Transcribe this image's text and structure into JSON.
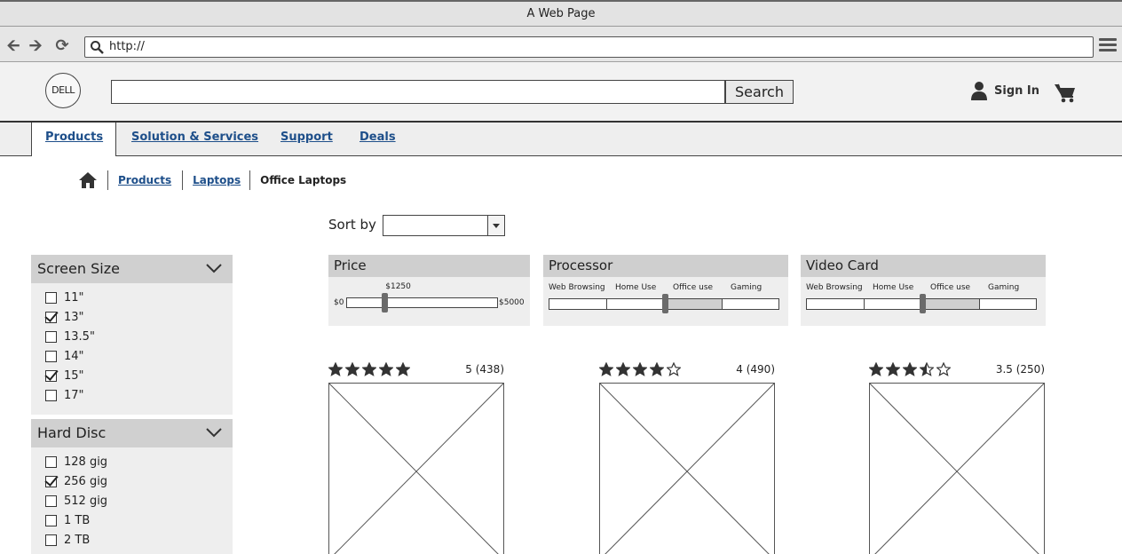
{
  "window": {
    "title": "A Web Page"
  },
  "browser": {
    "url": "http://"
  },
  "header": {
    "logo_text": "DELL",
    "search_value": "",
    "search_button": "Search",
    "sign_in": "Sign In"
  },
  "nav": {
    "tabs": [
      {
        "label": "Products",
        "active": true
      },
      {
        "label": "Solution & Services",
        "active": false
      },
      {
        "label": "Support",
        "active": false
      },
      {
        "label": "Deals",
        "active": false
      }
    ]
  },
  "breadcrumb": {
    "items": [
      "Products",
      "Laptops"
    ],
    "current": "Office Laptops"
  },
  "sort": {
    "label": "Sort by",
    "value": ""
  },
  "filters": {
    "screen_size": {
      "title": "Screen Size",
      "options": [
        {
          "label": "11\"",
          "checked": false
        },
        {
          "label": "13\"",
          "checked": true
        },
        {
          "label": "13.5\"",
          "checked": false
        },
        {
          "label": "14\"",
          "checked": false
        },
        {
          "label": "15\"",
          "checked": true
        },
        {
          "label": "17\"",
          "checked": false
        }
      ]
    },
    "hard_disc": {
      "title": "Hard Disc",
      "options": [
        {
          "label": "128 gig",
          "checked": false
        },
        {
          "label": "256 gig",
          "checked": true
        },
        {
          "label": "512 gig",
          "checked": false
        },
        {
          "label": "1 TB",
          "checked": false
        },
        {
          "label": "2 TB",
          "checked": false
        }
      ]
    }
  },
  "specs": {
    "price": {
      "title": "Price",
      "min_label": "$0",
      "max_label": "$5000",
      "value_label": "$1250",
      "min": 0,
      "max": 5000,
      "value": 1250
    },
    "processor": {
      "title": "Processor",
      "levels": [
        "Web Browsing",
        "Home Use",
        "Office use",
        "Gaming"
      ],
      "selected": "Office use"
    },
    "video_card": {
      "title": "Video Card",
      "levels": [
        "Web Browsing",
        "Home Use",
        "Office use",
        "Gaming"
      ],
      "selected": "Office use"
    }
  },
  "products": [
    {
      "rating": 5,
      "rating_text": "5 (438)"
    },
    {
      "rating": 4,
      "rating_text": "4 (490)"
    },
    {
      "rating": 3.5,
      "rating_text": "3.5 (250)"
    }
  ],
  "colors": {
    "link": "#1e4f8a",
    "panel": "#eeeeee",
    "panel_header": "#d0d0d0",
    "thumb": "#6b6b6b"
  }
}
